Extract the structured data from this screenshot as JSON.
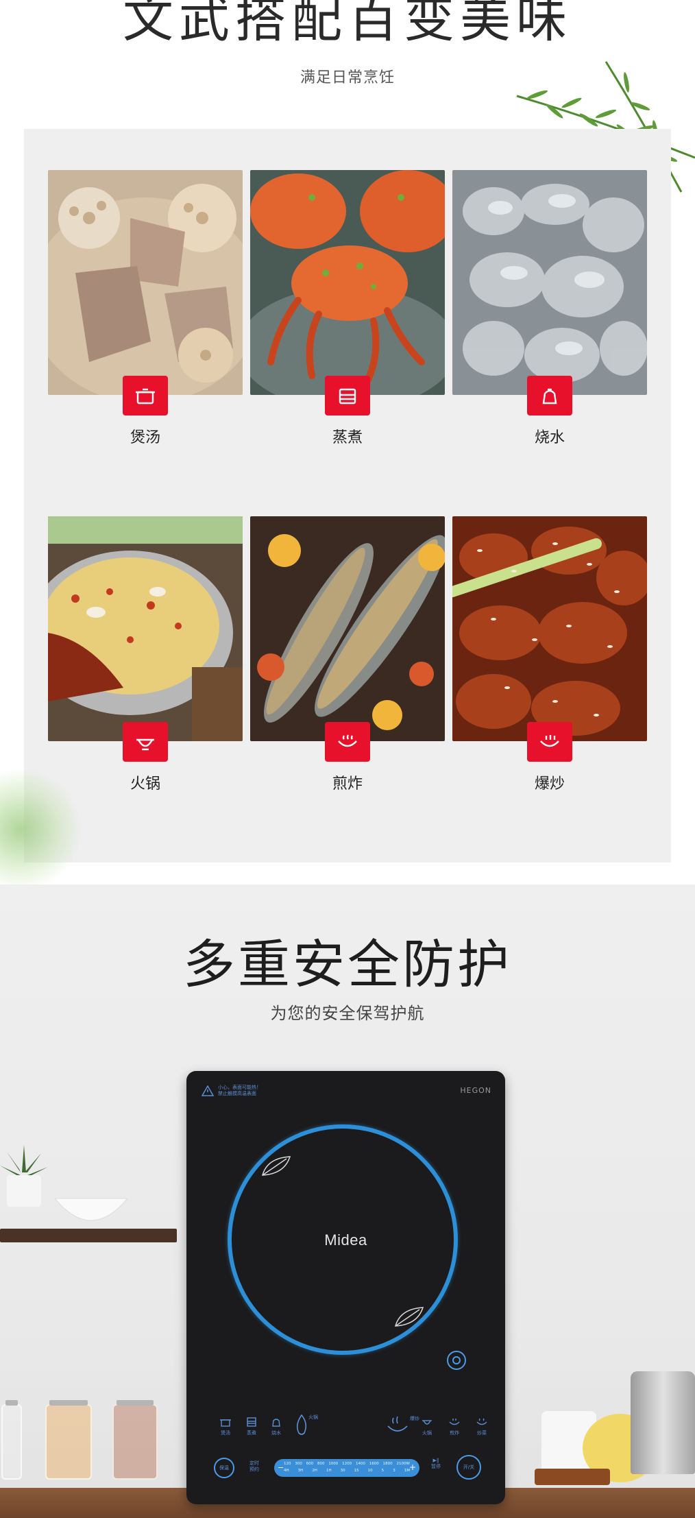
{
  "section1": {
    "title": "文武搭配百变美味",
    "subtitle": "满足日常烹饪",
    "cards": [
      {
        "label": "煲汤",
        "icon": "soup-pot-icon"
      },
      {
        "label": "蒸煮",
        "icon": "steamer-icon"
      },
      {
        "label": "烧水",
        "icon": "kettle-icon"
      },
      {
        "label": "火锅",
        "icon": "hotpot-icon"
      },
      {
        "label": "煎炸",
        "icon": "frying-pan-icon"
      },
      {
        "label": "爆炒",
        "icon": "wok-icon"
      }
    ],
    "accent": "#e8112b"
  },
  "section2": {
    "title": "多重安全防护",
    "subtitle": "为您的安全保驾护航"
  },
  "cooker": {
    "brand": "HEGON",
    "logo": "Midea",
    "warning": "小心，表面可能热！\n禁止触摸高温表面",
    "functions": [
      "煲汤",
      "蒸煮",
      "烧水",
      "火锅",
      "煎炸",
      "炒菜"
    ],
    "hotpot_label": "火锅",
    "stir_label": "爆炒",
    "timer_label": "定时 预约",
    "keep_warm_label": "保温",
    "pause_label": "暂停",
    "power_label": "开/关",
    "power_values": [
      "120",
      "300",
      "600",
      "800",
      "1000",
      "1200",
      "1400",
      "1600",
      "1800",
      "2100W"
    ],
    "time_values": [
      "4H",
      "3H",
      "2H",
      "1H",
      "30",
      "15",
      "10",
      "5",
      "3",
      "1M"
    ],
    "ring_color": "#2d8fd8"
  }
}
